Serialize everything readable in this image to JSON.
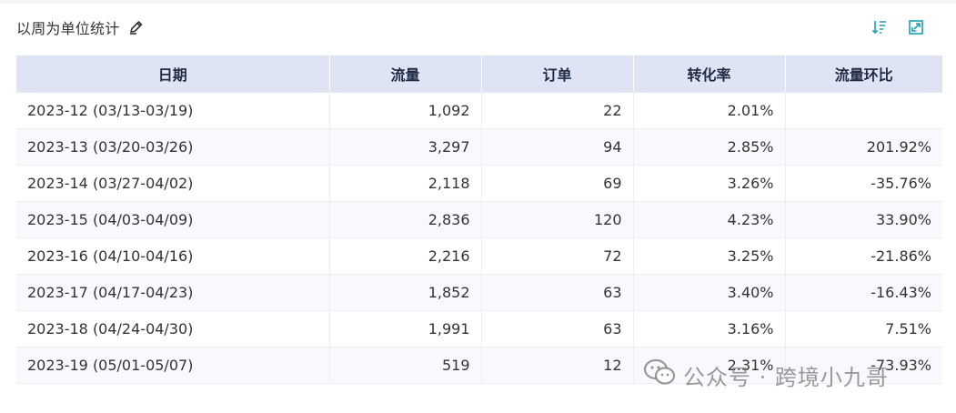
{
  "header": {
    "title": "以周为单位统计"
  },
  "icons": {
    "edit": "pen-icon",
    "sort": "sort-descending-icon",
    "expand": "expand-window-icon"
  },
  "colors": {
    "accent": "#1aa1b3",
    "header_bg": "#dfe4f4"
  },
  "table": {
    "columns": [
      "日期",
      "流量",
      "订单",
      "转化率",
      "流量环比"
    ],
    "rows": [
      [
        "2023-12 (03/13-03/19)",
        "1,092",
        "22",
        "2.01%",
        ""
      ],
      [
        "2023-13 (03/20-03/26)",
        "3,297",
        "94",
        "2.85%",
        "201.92%"
      ],
      [
        "2023-14 (03/27-04/02)",
        "2,118",
        "69",
        "3.26%",
        "-35.76%"
      ],
      [
        "2023-15 (04/03-04/09)",
        "2,836",
        "120",
        "4.23%",
        "33.90%"
      ],
      [
        "2023-16 (04/10-04/16)",
        "2,216",
        "72",
        "3.25%",
        "-21.86%"
      ],
      [
        "2023-17 (04/17-04/23)",
        "1,852",
        "63",
        "3.40%",
        "-16.43%"
      ],
      [
        "2023-18 (04/24-04/30)",
        "1,991",
        "63",
        "3.16%",
        "7.51%"
      ],
      [
        "2023-19 (05/01-05/07)",
        "519",
        "12",
        "2.31%",
        "-73.93%"
      ]
    ]
  },
  "watermark": {
    "text": "公众号 · 跨境小九哥"
  }
}
